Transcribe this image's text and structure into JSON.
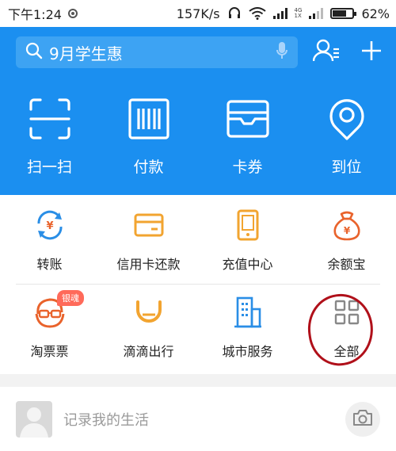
{
  "status_bar": {
    "time": "下午1:24",
    "net_speed": "157K/s",
    "net_top": "4G",
    "net_bottom": "1X",
    "battery_percent": 62,
    "battery_label": "62%"
  },
  "search": {
    "placeholder": "9月学生惠"
  },
  "quick_actions": [
    {
      "label": "扫一扫",
      "icon": "scan-icon"
    },
    {
      "label": "付款",
      "icon": "barcode-icon"
    },
    {
      "label": "卡券",
      "icon": "card-icon"
    },
    {
      "label": "到位",
      "icon": "location-icon"
    }
  ],
  "services_row1": [
    {
      "label": "转账",
      "icon": "transfer-icon"
    },
    {
      "label": "信用卡还款",
      "icon": "credit-card-icon"
    },
    {
      "label": "充值中心",
      "icon": "phone-icon"
    },
    {
      "label": "余额宝",
      "icon": "money-bag-icon"
    }
  ],
  "services_row2": [
    {
      "label": "淘票票",
      "icon": "movie-mascot-icon",
      "badge": "银魂"
    },
    {
      "label": "滴滴出行",
      "icon": "didi-icon"
    },
    {
      "label": "城市服务",
      "icon": "building-icon"
    },
    {
      "label": "全部",
      "icon": "grid-icon"
    }
  ],
  "post": {
    "placeholder": "记录我的生活"
  },
  "colors": {
    "header_blue": "#1b8ff0",
    "search_blue": "#3da3f3",
    "annotation_red": "#b0101a",
    "badge_red": "#ff6a5a"
  }
}
